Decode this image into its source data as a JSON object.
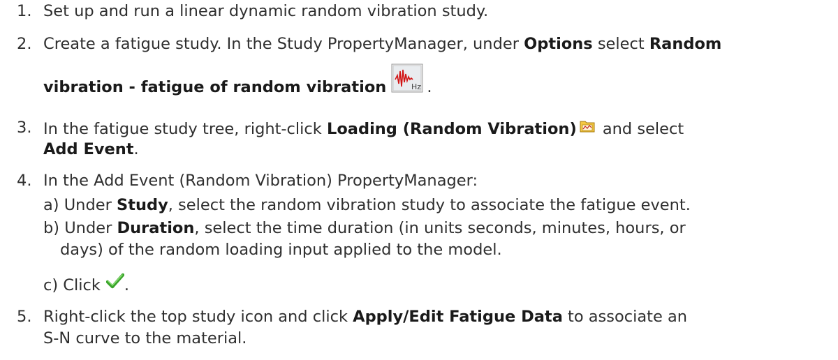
{
  "steps": [
    {
      "num": "1.",
      "text": "Set up and run a linear dynamic random vibration study."
    },
    {
      "num": "2.",
      "pre": "Create a fatigue study. In the Study PropertyManager, under ",
      "b1": "Options",
      "mid": " select ",
      "b2": "Random",
      "b3": "vibration - fatigue of random vibration",
      "post": "."
    },
    {
      "num": "3.",
      "pre": "In the fatigue study tree, right-click ",
      "b1": "Loading (Random Vibration)",
      "post": " and select",
      "b2": "Add Event",
      "end": "."
    },
    {
      "num": "4.",
      "text": "In the Add Event (Random Vibration) PropertyManager:",
      "subs": [
        {
          "pre": "a) Under ",
          "b": "Study",
          "post": ", select the random vibration study to associate the fatigue event."
        },
        {
          "pre": "b) Under ",
          "b": "Duration",
          "post": ", select the time duration (in units seconds, minutes, hours, or",
          "cont": "days) of the random loading input applied to the model."
        },
        {
          "pre": "c) Click",
          "post": "."
        }
      ]
    },
    {
      "num": "5.",
      "pre": "Right-click the top study icon and click ",
      "b1": "Apply/Edit Fatigue Data",
      "post": " to associate an",
      "cont": "S-N curve to the material."
    }
  ],
  "icons": {
    "random_vibration_fatigue": "waveform-hz-icon",
    "loading_folder": "folder-icon",
    "ok_check": "green-checkmark-icon"
  }
}
